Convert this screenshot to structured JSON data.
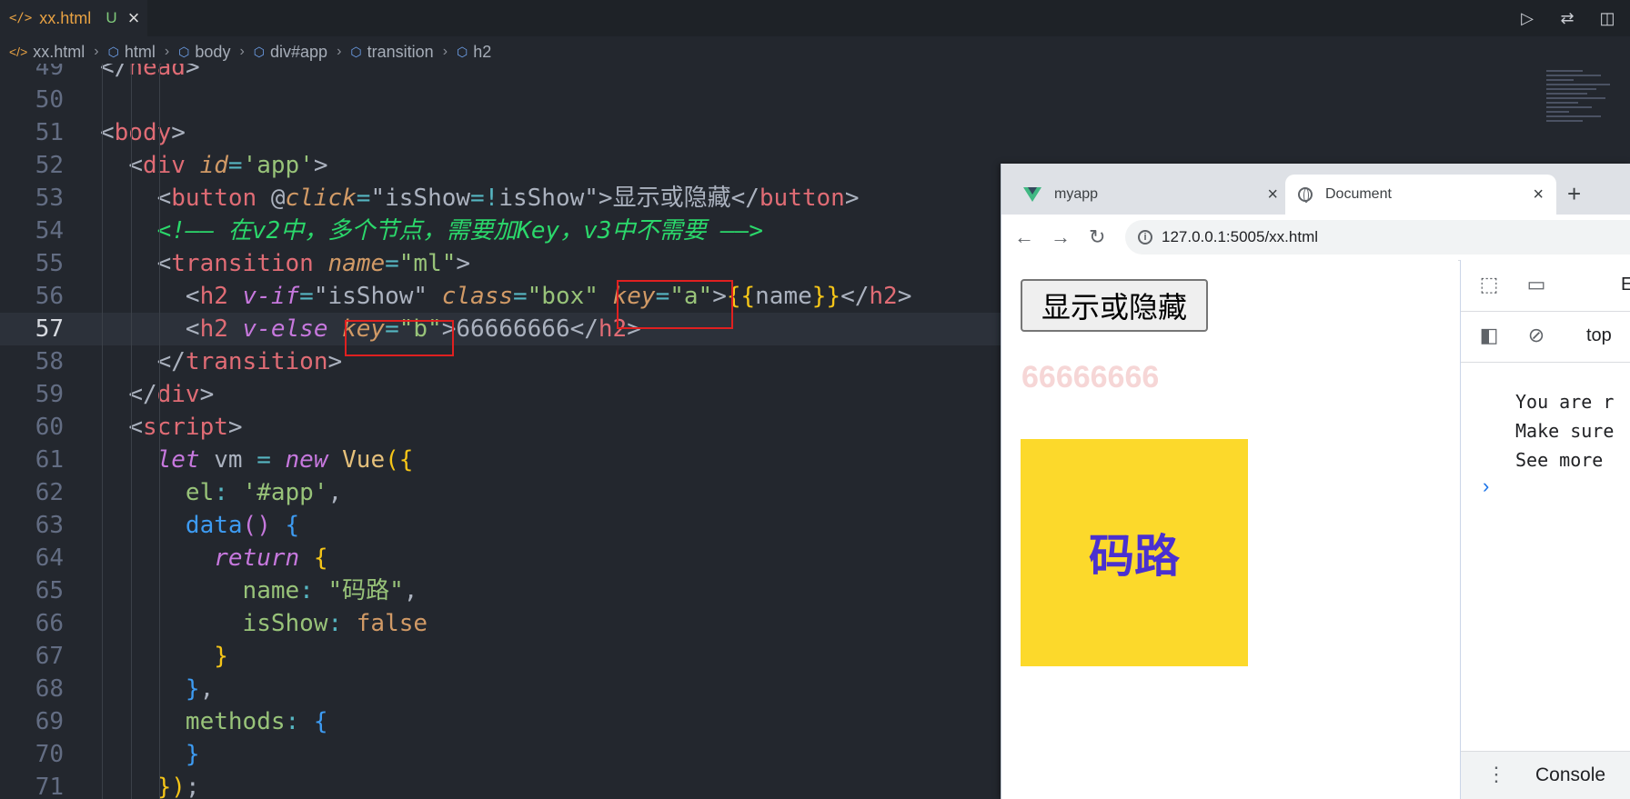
{
  "editor": {
    "tab": {
      "icon": "</>",
      "filename": "xx.html",
      "status": "U",
      "close": "×"
    },
    "actions": [
      {
        "name": "run-icon",
        "glyph": "▷"
      },
      {
        "name": "compare-changes-icon",
        "glyph": "⇄"
      },
      {
        "name": "split-editor-icon",
        "glyph": "◫"
      }
    ],
    "breadcrumb": [
      "xx.html",
      "html",
      "body",
      "div#app",
      "transition",
      "h2"
    ],
    "lines": [
      {
        "n": "49",
        "html": "<span class=\"p\">&lt;/</span><span class=\"t\">head</span><span class=\"p\">&gt;</span>"
      },
      {
        "n": "50",
        "html": ""
      },
      {
        "n": "51",
        "html": "<span class=\"p\">&lt;</span><span class=\"t\">body</span><span class=\"p\">&gt;</span>"
      },
      {
        "n": "52",
        "html": "  <span class=\"p\">&lt;</span><span class=\"t\">div</span> <span class=\"a\">id</span><span class=\"o\">=</span><span class=\"s\">'app'</span><span class=\"p\">&gt;</span>"
      },
      {
        "n": "53",
        "html": "    <span class=\"p\">&lt;</span><span class=\"t\">button</span> <span class=\"p\">@</span><span class=\"a\">click</span><span class=\"o\">=</span><span class=\"p\">\"</span><span class=\"p\">isShow</span><span class=\"o\">=!</span><span class=\"p\">isShow\"&gt;显示或隐藏&lt;/</span><span class=\"t\">button</span><span class=\"p\">&gt;</span>"
      },
      {
        "n": "54",
        "html": "    <span class=\"c\">&lt;!—— 在v2中，多个节点，需要加Key，v3中不需要 ——&gt;</span>"
      },
      {
        "n": "55",
        "html": "    <span class=\"p\">&lt;</span><span class=\"t\">transition</span> <span class=\"a\">name</span><span class=\"o\">=</span><span class=\"s\">\"ml\"</span><span class=\"p\">&gt;</span>"
      },
      {
        "n": "56",
        "html": "      <span class=\"p\">&lt;</span><span class=\"t\">h2</span> <span class=\"k\">v-if</span><span class=\"o\">=</span><span class=\"p\">\"isShow\"</span> <span class=\"a\">class</span><span class=\"o\">=</span><span class=\"s\">\"box\"</span> <span class=\"a\">key</span><span class=\"o\">=</span><span class=\"s\">\"a\"</span><span class=\"p\">&gt;</span><span class=\"y\">{{</span><span class=\"p\">name</span><span class=\"y\">}}</span><span class=\"p\">&lt;/</span><span class=\"t\">h2</span><span class=\"p\">&gt;</span>"
      },
      {
        "n": "57",
        "html": "      <span class=\"p\">&lt;</span><span class=\"t\">h2</span> <span class=\"k\">v-else</span> <span class=\"a\">key</span><span class=\"o\">=</span><span class=\"s\">\"b\"</span><span class=\"p\">&gt;66666666&lt;/</span><span class=\"t\">h2</span><span class=\"p\">&gt;</span>"
      },
      {
        "n": "58",
        "html": "    <span class=\"p\">&lt;/</span><span class=\"t\">transition</span><span class=\"p\">&gt;</span>"
      },
      {
        "n": "59",
        "html": "  <span class=\"p\">&lt;/</span><span class=\"t\">div</span><span class=\"p\">&gt;</span>"
      },
      {
        "n": "60",
        "html": "  <span class=\"p\">&lt;</span><span class=\"t\">script</span><span class=\"p\">&gt;</span>"
      },
      {
        "n": "61",
        "html": "    <span class=\"k\">let</span> <span class=\"p\">vm</span> <span class=\"o\">=</span> <span class=\"k\">new</span> <span class=\"cls\">Vue</span><span class=\"y\">({</span>"
      },
      {
        "n": "62",
        "html": "      <span class=\"s\">el</span><span class=\"o\">:</span> <span class=\"s\">'#app'</span><span class=\"p\">,</span>"
      },
      {
        "n": "63",
        "html": "      <span class=\"b\">data</span><span class=\"k\" style=\"font-style:normal\">()</span> <span class=\"b\">{</span>"
      },
      {
        "n": "64",
        "html": "        <span class=\"k\">return</span> <span class=\"y\">{</span>"
      },
      {
        "n": "65",
        "html": "          <span class=\"s\">name</span><span class=\"o\">:</span> <span class=\"s\">\"码路\"</span><span class=\"p\">,</span>"
      },
      {
        "n": "66",
        "html": "          <span class=\"s\">isShow</span><span class=\"o\">:</span> <span class=\"num\">false</span>"
      },
      {
        "n": "67",
        "html": "        <span class=\"y\">}</span>"
      },
      {
        "n": "68",
        "html": "      <span class=\"b\">}</span><span class=\"p\">,</span>"
      },
      {
        "n": "69",
        "html": "      <span class=\"s\">methods</span><span class=\"o\">:</span> <span class=\"b\">{</span>"
      },
      {
        "n": "70",
        "html": "      <span class=\"b\">}</span>"
      },
      {
        "n": "71",
        "html": "    <span class=\"y\">})</span><span class=\"p\">;</span>"
      }
    ],
    "current_line": "57"
  },
  "browser": {
    "tabs": [
      {
        "title": "myapp",
        "icon": "vue-logo-icon",
        "close": "×"
      },
      {
        "title": "Document",
        "icon": "globe-icon",
        "close": "×"
      }
    ],
    "new_tab": "+",
    "nav": {
      "back": "←",
      "forward": "→",
      "reload": "↻"
    },
    "url": "127.0.0.1:5005/xx.html",
    "page": {
      "button_label": "显示或隐藏",
      "h2_text": "66666666",
      "box_text": "码路"
    },
    "devtools": {
      "top_tab_partial": "E",
      "context_partial": "top",
      "console_lines": [
        "You are r",
        "Make sure",
        "See more "
      ],
      "prompt": "›",
      "bottom_menu": "⋮",
      "bottom_label": "Console"
    }
  },
  "colors": {
    "editor_bg": "#23272e",
    "tag": "#e06c75",
    "string": "#98c379",
    "comment": "#2bd86b",
    "box_bg": "#fcd92b",
    "box_text": "#4a30d0",
    "highlight_box": "#e02020"
  }
}
